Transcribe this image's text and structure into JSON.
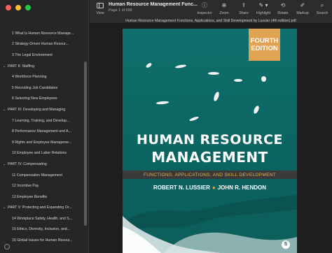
{
  "window": {
    "traffic_lights": {
      "close": "#fe5f57",
      "minimize": "#febc2e",
      "zoom": "#28c840"
    }
  },
  "toolbar": {
    "view_label": "View",
    "doc_title": "Human Resource Management Func...",
    "page_info": "Page 1 of 698",
    "tools": [
      {
        "name": "inspector",
        "icon": "info-icon",
        "label": "Inspector"
      },
      {
        "name": "zoom",
        "icon": "zoom-icon",
        "label": "Zoom"
      },
      {
        "name": "share",
        "icon": "share-icon",
        "label": "Share"
      },
      {
        "name": "highlight",
        "icon": "highlight-icon",
        "label": "Highlight"
      },
      {
        "name": "rotate",
        "icon": "rotate-icon",
        "label": "Rotate"
      },
      {
        "name": "markup",
        "icon": "markup-icon",
        "label": "Markup"
      },
      {
        "name": "search",
        "icon": "search-icon",
        "label": "Search"
      }
    ]
  },
  "sidebar": {
    "toc": [
      {
        "label": "1 What Is Human Resource Manage...",
        "level": 1
      },
      {
        "label": "2 Strategy-Driven Human Resour...",
        "level": 1
      },
      {
        "label": "3 The Legal Environment",
        "level": 1
      },
      {
        "label": "PART II: Staffing",
        "level": 0
      },
      {
        "label": "4 Workforce Planning",
        "level": 1
      },
      {
        "label": "5 Recruiting Job Candidates",
        "level": 1
      },
      {
        "label": "6 Selecting New Employees",
        "level": 1
      },
      {
        "label": "PART III: Developing and Managing",
        "level": 0
      },
      {
        "label": "7 Learning, Training, and Develop...",
        "level": 1
      },
      {
        "label": "8 Performance Management and A...",
        "level": 1
      },
      {
        "label": "9 Rights and Employee Manageme...",
        "level": 1
      },
      {
        "label": "10 Employee and Labor Relations",
        "level": 1
      },
      {
        "label": "PART IV: Compensating",
        "level": 0
      },
      {
        "label": "11 Compensation Management",
        "level": 1
      },
      {
        "label": "12 Incentive Pay",
        "level": 1
      },
      {
        "label": "13 Employee Benefits",
        "level": 1
      },
      {
        "label": "PART V: Protecting and Expanding Or...",
        "level": 0
      },
      {
        "label": "14 Workplace Safety, Health, and S...",
        "level": 1
      },
      {
        "label": "15 Ethics, Diversity, Inclusion, and...",
        "level": 1
      },
      {
        "label": "16 Global Issues for Human Resour...",
        "level": 1
      }
    ]
  },
  "document": {
    "file_name": "Human Resource Management Functions, Applications, and Skill Development by Lussier (4th edition).pdf"
  },
  "cover": {
    "edition_line1": "FOURTH",
    "edition_line2": "EDITION",
    "title_line1": "HUMAN RESOURCE",
    "title_line2": "MANAGEMENT",
    "subtitle": "FUNCTIONS, APPLICATIONS, AND SKILL DEVELOPMENT",
    "author1": "ROBERT N. LUSSIER",
    "author2": "JOHN R. HENDON",
    "colors": {
      "background": "#0c6663",
      "edition_badge": "#e0a353",
      "subtitle_text": "#e6b24b"
    }
  }
}
